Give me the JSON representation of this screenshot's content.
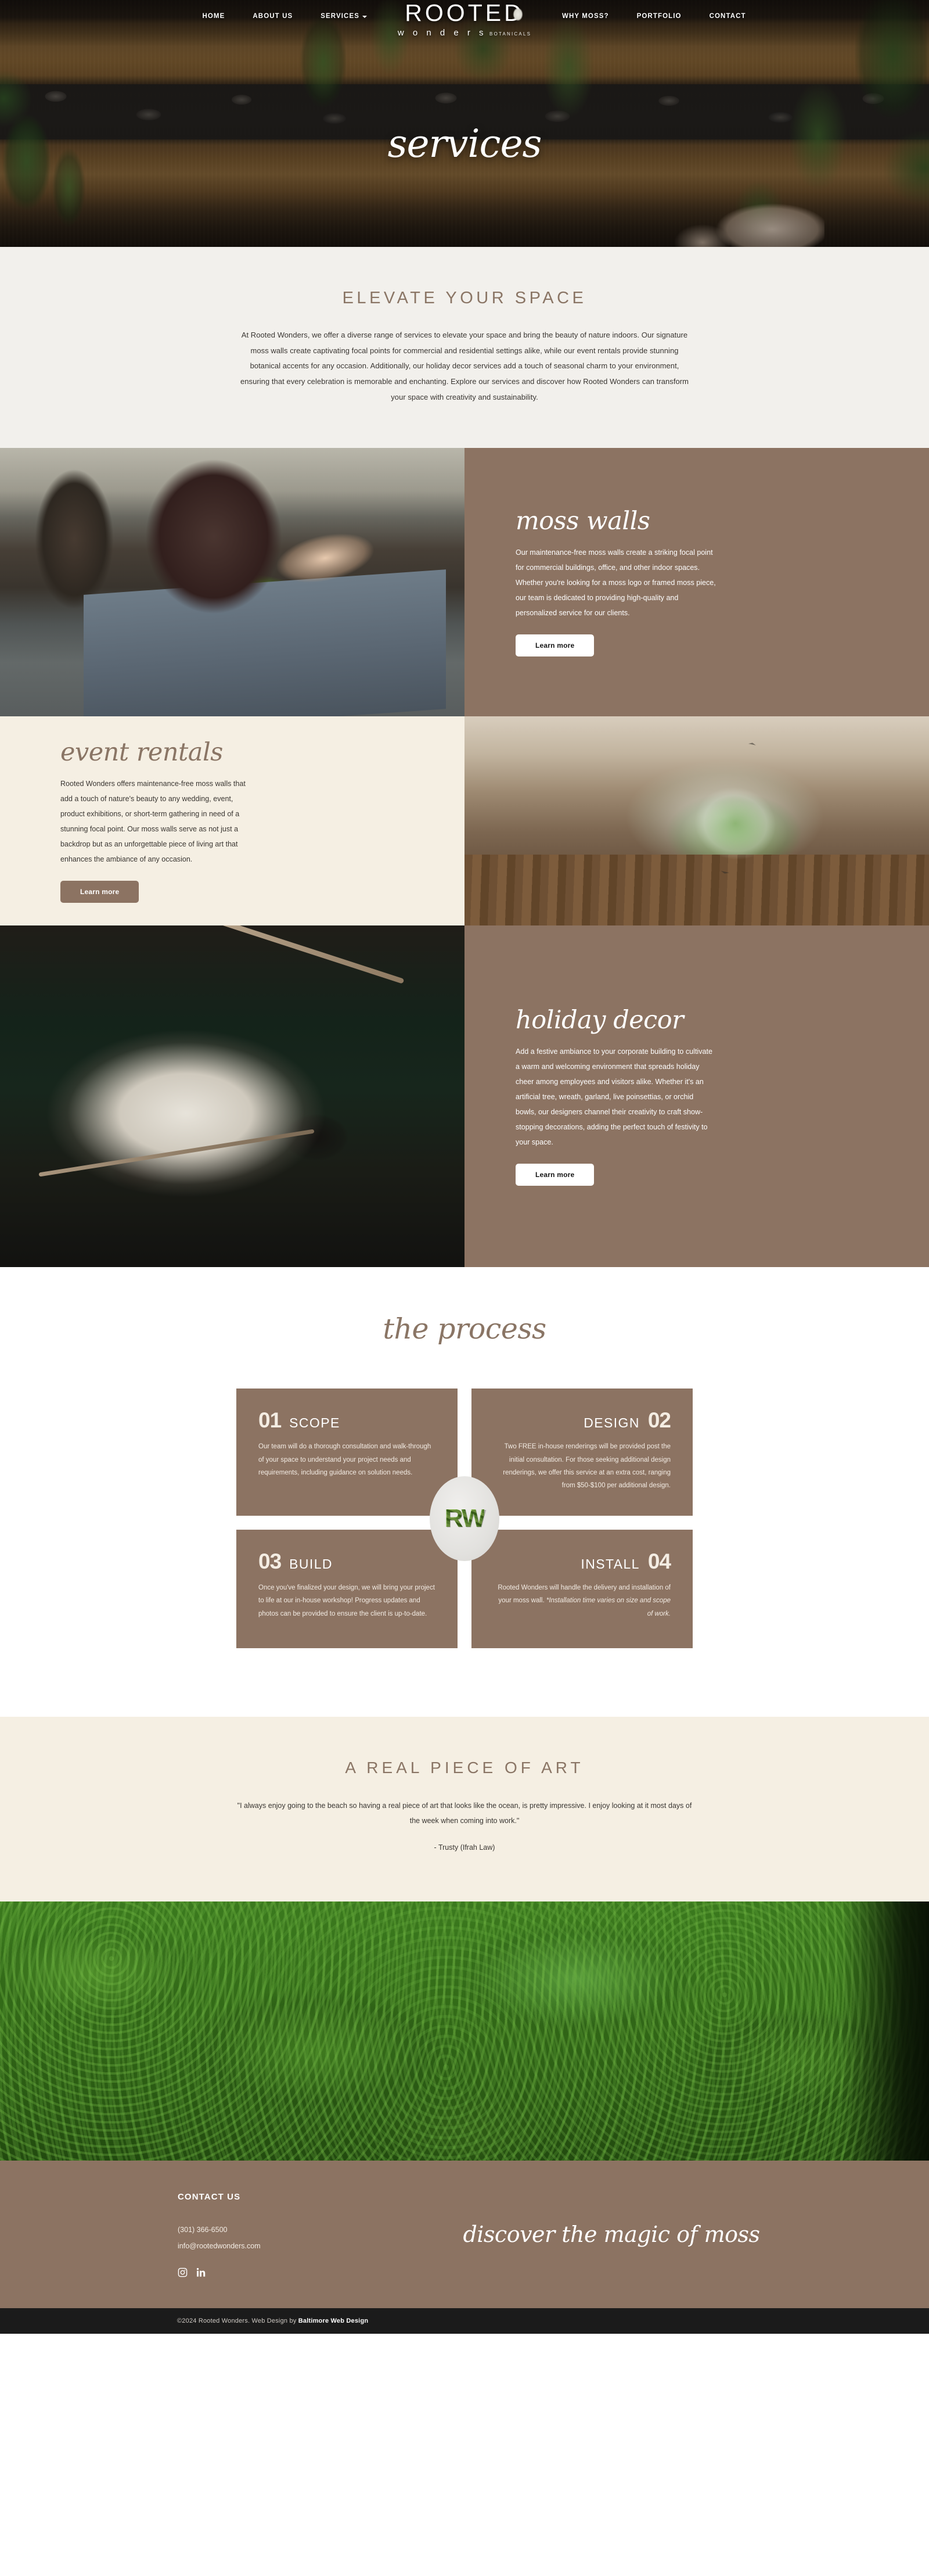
{
  "nav": {
    "left_items": [
      {
        "label": "HOME",
        "has_caret": false
      },
      {
        "label": "ABOUT US",
        "has_caret": false
      },
      {
        "label": "SERVICES",
        "has_caret": true
      }
    ],
    "right_items": [
      {
        "label": "WHY MOSS?",
        "has_caret": false
      },
      {
        "label": "PORTFOLIO",
        "has_caret": false
      },
      {
        "label": "CONTACT",
        "has_caret": false
      }
    ]
  },
  "brand": {
    "name": "ROOTED",
    "sub": "w o n d e r s",
    "sub_small": "BOTANICALS"
  },
  "hero": {
    "title": "services"
  },
  "intro": {
    "heading": "ELEVATE YOUR SPACE",
    "body": "At Rooted Wonders, we offer a diverse range of services to elevate your space and bring the beauty of nature indoors. Our signature moss walls create captivating focal points for commercial and residential settings alike, while our event rentals provide stunning botanical accents for any occasion. Additionally, our holiday decor services add a touch of seasonal charm to your environment, ensuring that every celebration is memorable and enchanting. Explore our services and discover how Rooted Wonders can transform your space with creativity and sustainability."
  },
  "services": [
    {
      "title": "moss walls",
      "body": "Our maintenance-free moss walls create a striking focal point for commercial buildings, office, and other indoor spaces. Whether you're looking for a moss logo or framed moss piece, our team is dedicated to providing high-quality and personalized service for our clients.",
      "button": "Learn more"
    },
    {
      "title": "event rentals",
      "body": "Rooted Wonders offers maintenance-free moss walls that add a touch of nature's beauty to any wedding, event, product exhibitions, or short-term gathering in need of a stunning focal point. Our moss walls serve as not just a backdrop but as an unforgettable piece of living art that enhances the ambiance of any occasion.",
      "button": "Learn more"
    },
    {
      "title": "holiday decor",
      "body": "Add a festive ambiance to your corporate building to cultivate a warm and welcoming environment that spreads holiday cheer among employees and visitors alike. Whether it's an artificial tree, wreath, garland, live poinsettias, or orchid bowls, our designers channel their creativity to craft show-stopping decorations, adding the perfect touch of festivity to your space.",
      "button": "Learn more"
    }
  ],
  "process": {
    "heading": "the process",
    "badge": "RW",
    "cards": [
      {
        "number": "01",
        "title": "SCOPE",
        "body": "Our team will do a thorough consultation and walk-through of your space to understand your project needs and requirements, including guidance on solution needs.",
        "align": "left"
      },
      {
        "number": "02",
        "title": "DESIGN",
        "body": "Two FREE in-house renderings will be provided post the initial consultation. For those seeking additional design renderings, we offer this service at an extra cost, ranging from $50-$100 per additional design.",
        "align": "right"
      },
      {
        "number": "03",
        "title": "BUILD",
        "body": "Once you've finalized your design, we will bring your project to life at our in-house workshop! Progress updates and photos can be provided to ensure the client is up-to-date.",
        "align": "left"
      },
      {
        "number": "04",
        "title": "INSTALL",
        "body_plain": "Rooted Wonders will handle the delivery and installation of your moss wall. ",
        "body_italic": "*Installation time varies on size and scope of work.",
        "align": "right"
      }
    ]
  },
  "testimonial": {
    "heading": "A REAL PIECE OF ART",
    "quote": "\"I always enjoy going to the beach so having a real piece of art that looks like the ocean, is pretty impressive. I enjoy looking at it most days of the week when coming into work.\"",
    "attribution": "- Trusty (Ifrah Law)"
  },
  "footer": {
    "contact_heading": "CONTACT US",
    "phone": "(301) 366-6500",
    "email": "info@rootedwonders.com",
    "tagline": "discover the magic of moss",
    "socials": [
      "instagram-icon",
      "linkedin-icon"
    ]
  },
  "copyright": {
    "prefix": "©2024 Rooted Wonders. Web Design by ",
    "link": "Baltimore Web Design"
  },
  "colors": {
    "brown": "#8C7362",
    "cream": "#F5EFE3",
    "light_gray": "#F2F0EC",
    "heading_brown": "#8A7565",
    "dark_bar": "#1B1B1B"
  }
}
